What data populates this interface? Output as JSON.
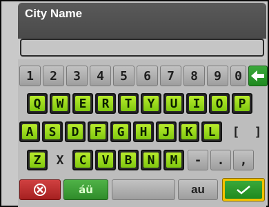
{
  "title": "City Name",
  "input": {
    "value": ""
  },
  "rows": {
    "digits": [
      "1",
      "2",
      "3",
      "4",
      "5",
      "6",
      "7",
      "8",
      "9",
      "0"
    ],
    "row_q": [
      "Q",
      "W",
      "E",
      "R",
      "T",
      "Y",
      "U",
      "I",
      "O",
      "P"
    ],
    "row_a": [
      "A",
      "S",
      "D",
      "F",
      "G",
      "H",
      "J",
      "K",
      "L",
      "[",
      "]"
    ],
    "row_z": [
      "Z",
      "X",
      "C",
      "V",
      "B",
      "N",
      "M",
      "-",
      ".",
      ","
    ]
  },
  "actions": {
    "accents_label": "áü",
    "lang_label": "au"
  },
  "colors": {
    "key_green": "#9fe01e",
    "key_grey": "#b0b0b0",
    "enter_border": "#f2c200",
    "cancel_red": "#c03030"
  },
  "icons": {
    "backspace": "backspace-arrow-icon",
    "cancel": "cancel-icon",
    "confirm": "checkmark-icon"
  }
}
